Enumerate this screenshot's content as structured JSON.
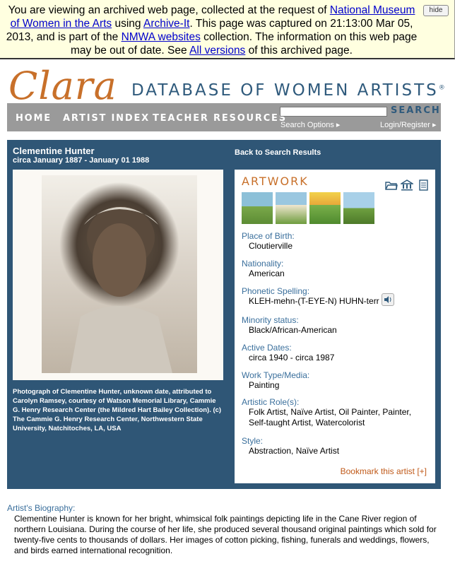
{
  "banner": {
    "text_1": "You are viewing an archived web page, collected at the request of ",
    "link_museum": "National Museum of Women in the Arts",
    "text_2": " using ",
    "link_archive": "Archive-It",
    "text_3": ". This page was captured on 21:13:00 Mar 05, 2013, and is part of the ",
    "link_collection": "NMWA websites",
    "text_4": " collection. The information on this web page may be out of date. See ",
    "link_versions": "All versions",
    "text_5": " of this archived page.",
    "hide_label": "hide"
  },
  "header": {
    "logo": "Clara",
    "tagline": "DATABASE OF WOMEN ARTISTS",
    "registered": "®"
  },
  "nav": {
    "home": "HOME",
    "artist_index": "ARTIST INDEX",
    "teacher_resources": "TEACHER RESOURCES",
    "search_label": "SEARCH",
    "search_options": "Search Options ▸",
    "login": "Login/Register ▸"
  },
  "artist": {
    "name": "Clementine Hunter",
    "dates": "circa January 1887 - January 01 1988",
    "back_link": "Back to Search Results",
    "caption": "Photograph of Clementine Hunter, unknown date, attributed to Carolyn Ramsey, courtesy of Watson Memorial Library, Cammie G. Henry Research Center (the Mildred Hart Bailey Collection). (c) The Cammie G. Henry Research Center, Northwestern State University, Natchitoches, LA, USA"
  },
  "info": {
    "artwork_title": "ARTWORK",
    "fields": [
      {
        "label": "Place of Birth:",
        "value": "Cloutierville"
      },
      {
        "label": "Nationality:",
        "value": "American"
      },
      {
        "label": "Phonetic Spelling:",
        "value": "KLEH-mehn-(T-EYE-N) HUHN-terr"
      },
      {
        "label": "Minority status:",
        "value": "Black/African-American"
      },
      {
        "label": "Active Dates:",
        "value": "circa 1940 - circa 1987"
      },
      {
        "label": "Work Type/Media:",
        "value": "Painting"
      },
      {
        "label": "Artistic Role(s):",
        "value": "Folk Artist, Naïve Artist, Oil Painter, Painter, Self-taught Artist, Watercolorist"
      },
      {
        "label": "Style:",
        "value": "Abstraction, Naïve Artist"
      }
    ],
    "bookmark": "Bookmark this artist [+]"
  },
  "bio": {
    "label": "Artist's Biography:",
    "text": "Clementine Hunter is known for her bright, whimsical folk paintings depicting life in the Cane River region of northern Louisiana. During the course of her life, she produced several thousand original paintings which sold for twenty-five cents to thousands of dollars. Her images of cotton picking, fishing, funerals and weddings, flowers, and birds earned international recognition."
  },
  "colors": {
    "accent": "#c8702a",
    "panel": "#2f5676",
    "label": "#3a6f9c",
    "nav": "#9a9a9a"
  }
}
